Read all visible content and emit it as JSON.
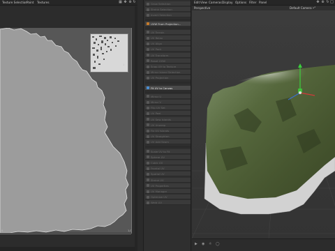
{
  "uv_editor": {
    "menu": [
      {
        "label": "Texture Selection"
      },
      {
        "label": "Paint"
      },
      {
        "label": "Textures"
      }
    ],
    "nav_icons": [
      "grid-icon",
      "move-icon",
      "zoom-icon",
      "rotate-icon"
    ],
    "grid_labels": {
      "top_right": "1",
      "bottom_left": "0",
      "bottom_right": "1,0"
    }
  },
  "tool_panel": {
    "items": [
      {
        "label": "Grow Selection",
        "state": "dim"
      },
      {
        "label": "Shrink Selection",
        "state": "dim"
      },
      {
        "label": "Invert Selection",
        "state": "dim"
      },
      {
        "label": "UVW From Projection...",
        "state": "active"
      },
      {
        "label": "UV Terrain",
        "state": "dim"
      },
      {
        "label": "UV Relax",
        "state": "dim"
      },
      {
        "label": "UV Align",
        "state": "dim"
      },
      {
        "label": "UV Pack",
        "state": "dim"
      },
      {
        "label": "UV Transform",
        "state": "dim"
      },
      {
        "label": "Reset UVW",
        "state": "dim"
      },
      {
        "label": "Snap UV to Texture",
        "state": "dim"
      },
      {
        "label": "Mirror Island Selection",
        "state": "dim"
      },
      {
        "label": "UV Projection",
        "state": "dim"
      },
      {
        "label": "Fit UV to Canvas",
        "state": "highlight"
      },
      {
        "label": "Mirror U",
        "state": "dim"
      },
      {
        "label": "Mirror V",
        "state": "dim"
      },
      {
        "label": "Flip UV Set",
        "state": "dim"
      },
      {
        "label": "UV Peel",
        "state": "dim"
      },
      {
        "label": "UV Sew Islands",
        "state": "dim"
      },
      {
        "label": "UV Unwrap",
        "state": "dim"
      },
      {
        "label": "Fix UV Islands",
        "state": "dim"
      },
      {
        "label": "UV Straighten",
        "state": "dim"
      },
      {
        "label": "UV Add Seam",
        "state": "dim"
      },
      {
        "label": "Scale UV to Fit",
        "state": "dim"
      },
      {
        "label": "Sphere UV",
        "state": "dim"
      },
      {
        "label": "Cubic UV",
        "state": "dim"
      },
      {
        "label": "Frontal UV",
        "state": "dim"
      },
      {
        "label": "Spatial UV",
        "state": "dim"
      },
      {
        "label": "Shrink UV",
        "state": "dim"
      },
      {
        "label": "UV Properties",
        "state": "dim"
      },
      {
        "label": "UV Manager",
        "state": "dim"
      },
      {
        "label": "Optimize UV",
        "state": "dim"
      },
      {
        "label": "Weld UV",
        "state": "dim"
      }
    ]
  },
  "viewport": {
    "menu": [
      {
        "label": "Edit"
      },
      {
        "label": "View"
      },
      {
        "label": "Cameras"
      },
      {
        "label": "Display"
      },
      {
        "label": "Options"
      },
      {
        "label": "Filter"
      },
      {
        "label": "Panel"
      }
    ],
    "view_name": "Perspective",
    "camera_name": "Default Camera •°"
  },
  "colors": {
    "accent_orange": "#c77b2a",
    "accent_blue": "#4a8fd4",
    "uv_island": "#9c9c9c",
    "terrain_green": "#56683d"
  }
}
